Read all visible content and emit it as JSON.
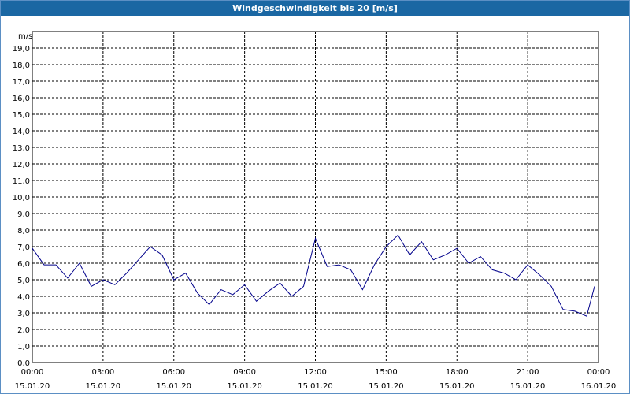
{
  "window": {
    "title": "Windgeschwindigkeit bis 20 [m/s]"
  },
  "colors": {
    "title_bar": "#1a67a3",
    "line": "#00008b",
    "grid": "#000000"
  },
  "chart_data": {
    "type": "line",
    "title": "Windgeschwindigkeit bis 20 [m/s]",
    "ylabel": "m/s",
    "ylim": [
      0,
      20
    ],
    "y_ticks": [
      "0,0",
      "1,0",
      "2,0",
      "3,0",
      "4,0",
      "5,0",
      "6,0",
      "7,0",
      "8,0",
      "9,0",
      "10,0",
      "11,0",
      "12,0",
      "13,0",
      "14,0",
      "15,0",
      "16,0",
      "17,0",
      "18,0",
      "19,0"
    ],
    "x_range": [
      "15.01.20 00:00",
      "16.01.20 00:00"
    ],
    "x_ticks": [
      {
        "time": "00:00",
        "date": "15.01.20"
      },
      {
        "time": "03:00",
        "date": "15.01.20"
      },
      {
        "time": "06:00",
        "date": "15.01.20"
      },
      {
        "time": "09:00",
        "date": "15.01.20"
      },
      {
        "time": "12:00",
        "date": "15.01.20"
      },
      {
        "time": "15:00",
        "date": "15.01.20"
      },
      {
        "time": "18:00",
        "date": "15.01.20"
      },
      {
        "time": "21:00",
        "date": "15.01.20"
      },
      {
        "time": "00:00",
        "date": "16.01.20"
      }
    ],
    "grid": true,
    "series": [
      {
        "x": [
          "00:00",
          "00:30",
          "01:00",
          "01:30",
          "02:00",
          "02:30",
          "03:00",
          "03:30",
          "04:00",
          "04:30",
          "05:00",
          "05:30",
          "06:00",
          "06:30",
          "07:00",
          "07:30",
          "08:00",
          "08:30",
          "09:00",
          "09:30",
          "10:00",
          "10:30",
          "11:00",
          "11:30",
          "12:00",
          "12:30",
          "13:00",
          "13:30",
          "14:00",
          "14:30",
          "15:00",
          "15:30",
          "16:00",
          "16:30",
          "17:00",
          "17:30",
          "18:00",
          "18:30",
          "19:00",
          "19:30",
          "20:00",
          "20:30",
          "21:00",
          "21:30",
          "22:00",
          "22:30",
          "23:00",
          "23:30",
          "23:50"
        ],
        "values": [
          6.9,
          5.9,
          5.9,
          5.1,
          6.0,
          4.6,
          5.0,
          4.7,
          5.4,
          6.2,
          7.0,
          6.5,
          5.0,
          5.4,
          4.2,
          3.5,
          4.4,
          4.1,
          4.7,
          3.7,
          4.3,
          4.8,
          4.0,
          4.6,
          7.5,
          5.8,
          5.9,
          5.6,
          4.4,
          5.9,
          7.0,
          7.7,
          6.5,
          7.3,
          6.2,
          6.5,
          6.9,
          6.0,
          6.4,
          5.6,
          5.4,
          5.0,
          5.9,
          5.3,
          4.6,
          3.2,
          3.1,
          2.8,
          4.6
        ]
      }
    ]
  }
}
